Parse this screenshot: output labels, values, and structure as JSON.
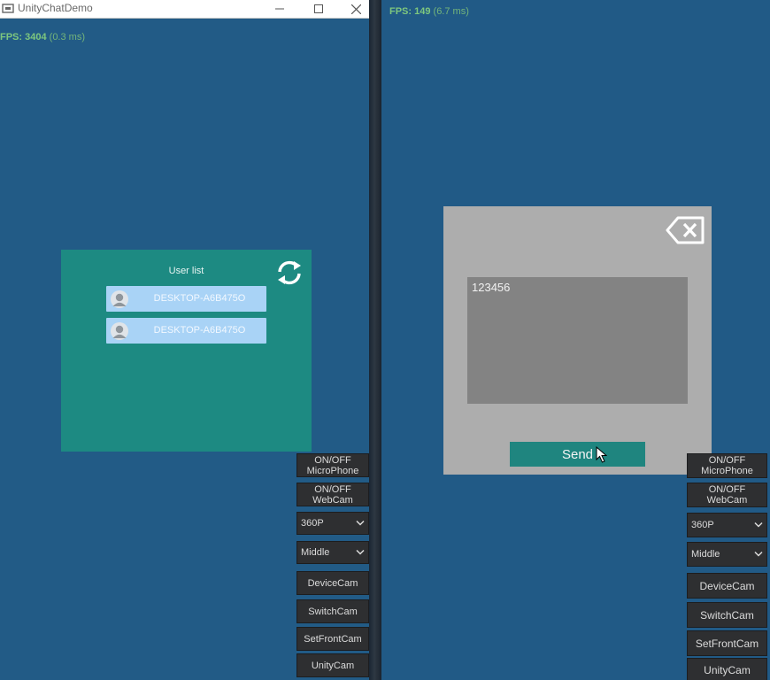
{
  "left_window": {
    "title": "UnityChatDemo",
    "fps_label": "FPS: 3404",
    "fps_ms": "(0.3 ms)",
    "user_list": {
      "title": "User list",
      "users": [
        {
          "name": "DESKTOP-A6B475O"
        },
        {
          "name": "DESKTOP-A6B475O"
        }
      ]
    },
    "controls": {
      "microphone": "ON/OFF\nMicroPhone",
      "webcam": "ON/OFF\nWebCam",
      "resolution": "360P",
      "quality": "Middle",
      "device_cam": "DeviceCam",
      "switch_cam": "SwitchCam",
      "set_front_cam": "SetFrontCam",
      "unity_cam": "UnityCam"
    }
  },
  "right_window": {
    "fps_label": "FPS: 149",
    "fps_ms": "(6.7 ms)",
    "chat": {
      "message": "123456",
      "send_label": "Send"
    },
    "controls": {
      "microphone": "ON/OFF\nMicroPhone",
      "webcam": "ON/OFF\nWebCam",
      "resolution": "360P",
      "quality": "Middle",
      "device_cam": "DeviceCam",
      "switch_cam": "SwitchCam",
      "set_front_cam": "SetFrontCam",
      "unity_cam": "UnityCam"
    }
  },
  "icons": {
    "app": "app-icon",
    "refresh": "refresh-icon",
    "avatar": "user-avatar-icon",
    "close": "backspace-close-icon",
    "dropdown": "chevron-down-icon"
  },
  "colors": {
    "background": "#225b86",
    "panel_teal": "#1d8a82",
    "user_item": "#a9d3f6",
    "dialog_gray": "#adadad",
    "input_gray": "#838383",
    "fps_green": "#7ec77e",
    "button_dark": "#2e2f31"
  }
}
